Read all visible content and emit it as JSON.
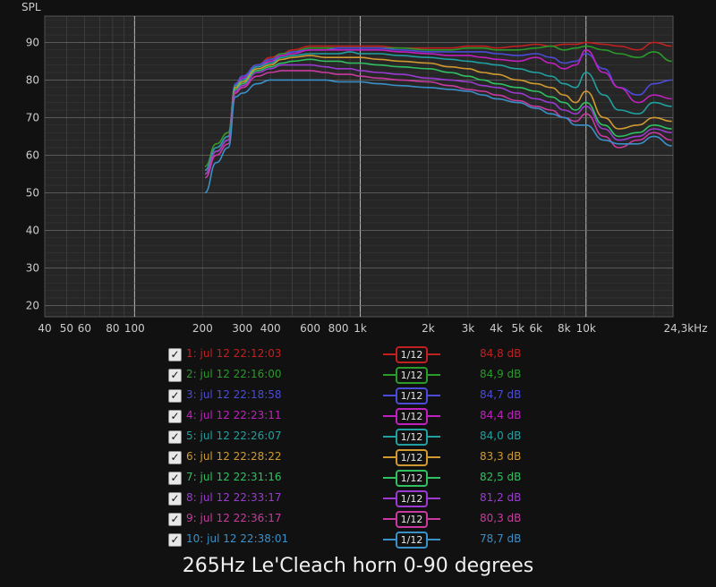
{
  "chart_data": {
    "type": "line",
    "title": "265Hz Le'Cleach horn 0-90 degrees",
    "ylabel": "SPL",
    "xlabel": "",
    "x_scale": "log",
    "xlim": [
      40,
      24300
    ],
    "ylim": [
      17,
      97
    ],
    "x_ticks": [
      40,
      50,
      60,
      80,
      100,
      200,
      300,
      400,
      600,
      800,
      1000,
      2000,
      3000,
      4000,
      5000,
      6000,
      8000,
      10000,
      24300
    ],
    "x_tick_labels": [
      "40",
      "50",
      "60",
      "80",
      "100",
      "200",
      "300",
      "400",
      "600",
      "800",
      "1k",
      "2k",
      "3k",
      "4k",
      "5k",
      "6k",
      "8k",
      "10k",
      "24,3kHz"
    ],
    "y_ticks": [
      20,
      30,
      40,
      50,
      60,
      70,
      80,
      90
    ],
    "grid": true,
    "x": [
      205,
      230,
      260,
      280,
      300,
      350,
      400,
      450,
      500,
      600,
      700,
      800,
      900,
      1000,
      1200,
      1500,
      2000,
      2500,
      3000,
      3500,
      4000,
      5000,
      6000,
      7000,
      8000,
      9000,
      10000,
      12000,
      14000,
      17000,
      20000,
      24000
    ],
    "series": [
      {
        "name": "1: jul 12 22:12:03",
        "color": "#c22020",
        "values": [
          57,
          63,
          66,
          79,
          81,
          84,
          86,
          87,
          88,
          89,
          89,
          89,
          89,
          89,
          89,
          88.5,
          88.5,
          88.5,
          89,
          89,
          88.5,
          89,
          89.5,
          89,
          89.5,
          89.5,
          90,
          89.5,
          89,
          88,
          90,
          89
        ]
      },
      {
        "name": "2: jul 12 22:16:00",
        "color": "#2a9a2a",
        "values": [
          57,
          63,
          66,
          79,
          81,
          84,
          85.5,
          87,
          87.5,
          88.5,
          88.5,
          88.5,
          88.5,
          88.5,
          88.5,
          88.5,
          88,
          88,
          88.5,
          88.5,
          88,
          88,
          88.5,
          89,
          88,
          88.5,
          89,
          88,
          87,
          86,
          87.5,
          85
        ]
      },
      {
        "name": "3: jul 12 22:18:58",
        "color": "#4b4bd8",
        "values": [
          56,
          62,
          65,
          79,
          81,
          84,
          85.5,
          86.5,
          87.5,
          88,
          88,
          88.5,
          88.5,
          88.5,
          88.5,
          88,
          87.5,
          87.5,
          87.5,
          87.5,
          87,
          86.5,
          87,
          86,
          84.5,
          85,
          87,
          83,
          78,
          76,
          79,
          80
        ]
      },
      {
        "name": "4: jul 12 22:23:11",
        "color": "#c020c0",
        "values": [
          56,
          62,
          65,
          78.5,
          80.5,
          83.5,
          85,
          86.5,
          87,
          88,
          88,
          88,
          88,
          88,
          88,
          87.5,
          87,
          86.5,
          86.5,
          86,
          85.5,
          85,
          86,
          84.5,
          83,
          84,
          88,
          82,
          78,
          74,
          76,
          75
        ]
      },
      {
        "name": "5: jul 12 22:26:07",
        "color": "#20a0a0",
        "values": [
          56,
          62,
          65,
          78.5,
          80,
          83.5,
          84.5,
          86,
          86.5,
          87,
          87,
          87,
          87.5,
          87,
          87,
          86.5,
          86,
          85.5,
          85,
          84.5,
          84,
          83,
          82,
          81,
          79,
          78,
          82,
          76,
          72,
          71,
          74,
          73
        ]
      },
      {
        "name": "6: jul 12 22:28:22",
        "color": "#d09a30",
        "values": [
          55,
          61,
          64,
          78,
          79.5,
          83,
          84,
          85.5,
          86,
          86.5,
          86,
          86,
          86,
          86,
          85.5,
          85,
          84.5,
          83.5,
          83,
          82,
          81.5,
          80,
          79,
          78,
          76,
          74,
          77,
          70,
          67,
          68,
          70,
          69
        ]
      },
      {
        "name": "7: jul 12 22:31:16",
        "color": "#30c060",
        "values": [
          55,
          61,
          64,
          77.5,
          79,
          82.5,
          83.5,
          84.5,
          85,
          85.5,
          85,
          85,
          84.5,
          84.5,
          84,
          83.5,
          83,
          82,
          81,
          80,
          79,
          78,
          77,
          75.5,
          74,
          72,
          74,
          68,
          65,
          66,
          68,
          67
        ]
      },
      {
        "name": "8: jul 12 22:33:17",
        "color": "#9a3ad0",
        "values": [
          55,
          61,
          64,
          77,
          78.5,
          82,
          83,
          84,
          84,
          84,
          83.5,
          83,
          83,
          82.5,
          82,
          81.5,
          80.5,
          80,
          79.5,
          78.5,
          78,
          76.5,
          75,
          74,
          72,
          71,
          73,
          67,
          64,
          65,
          67,
          66
        ]
      },
      {
        "name": "9: jul 12 22:36:17",
        "color": "#c83aa0",
        "values": [
          54,
          60,
          63,
          76.5,
          78,
          81,
          82,
          82.5,
          82.5,
          82.5,
          82,
          81.5,
          81.5,
          81,
          80.5,
          80,
          79.5,
          78.5,
          77.5,
          77,
          76,
          74.5,
          73,
          72,
          70,
          69,
          71,
          65,
          62,
          64,
          66,
          64
        ]
      },
      {
        "name": "10: jul 12 22:38:01",
        "color": "#3a90c8",
        "values": [
          50,
          58,
          62,
          75.5,
          76.5,
          79,
          80,
          80,
          80,
          80,
          80,
          79.5,
          79.5,
          79.5,
          79,
          78.5,
          78,
          77.5,
          77,
          76,
          75,
          74,
          72.5,
          71,
          70,
          68,
          68,
          64,
          63,
          63,
          65,
          62.5
        ]
      }
    ]
  },
  "legend": {
    "rows": [
      {
        "name": "1: jul 12 22:12:03",
        "smoothing": "1/12",
        "value": "84,8 dB",
        "color": "#c22020"
      },
      {
        "name": "2: jul 12 22:16:00",
        "smoothing": "1/12",
        "value": "84,9 dB",
        "color": "#2a9a2a"
      },
      {
        "name": "3: jul 12 22:18:58",
        "smoothing": "1/12",
        "value": "84,7 dB",
        "color": "#4b4bd8"
      },
      {
        "name": "4: jul 12 22:23:11",
        "smoothing": "1/12",
        "value": "84,4 dB",
        "color": "#c020c0"
      },
      {
        "name": "5: jul 12 22:26:07",
        "smoothing": "1/12",
        "value": "84,0 dB",
        "color": "#20a0a0"
      },
      {
        "name": "6: jul 12 22:28:22",
        "smoothing": "1/12",
        "value": "83,3 dB",
        "color": "#d09a30"
      },
      {
        "name": "7: jul 12 22:31:16",
        "smoothing": "1/12",
        "value": "82,5 dB",
        "color": "#30c060"
      },
      {
        "name": "8: jul 12 22:33:17",
        "smoothing": "1/12",
        "value": "81,2 dB",
        "color": "#9a3ad0"
      },
      {
        "name": "9: jul 12 22:36:17",
        "smoothing": "1/12",
        "value": "80,3 dB",
        "color": "#c83aa0"
      },
      {
        "name": "10: jul 12 22:38:01",
        "smoothing": "1/12",
        "value": "78,7 dB",
        "color": "#3a90c8"
      }
    ],
    "check_glyph": "✓"
  },
  "colors": {
    "background": "#111111",
    "plot_background": "#262626",
    "grid": "#4a4a4a",
    "grid_major": "#bbbbbb",
    "axis_text": "#cccccc"
  }
}
